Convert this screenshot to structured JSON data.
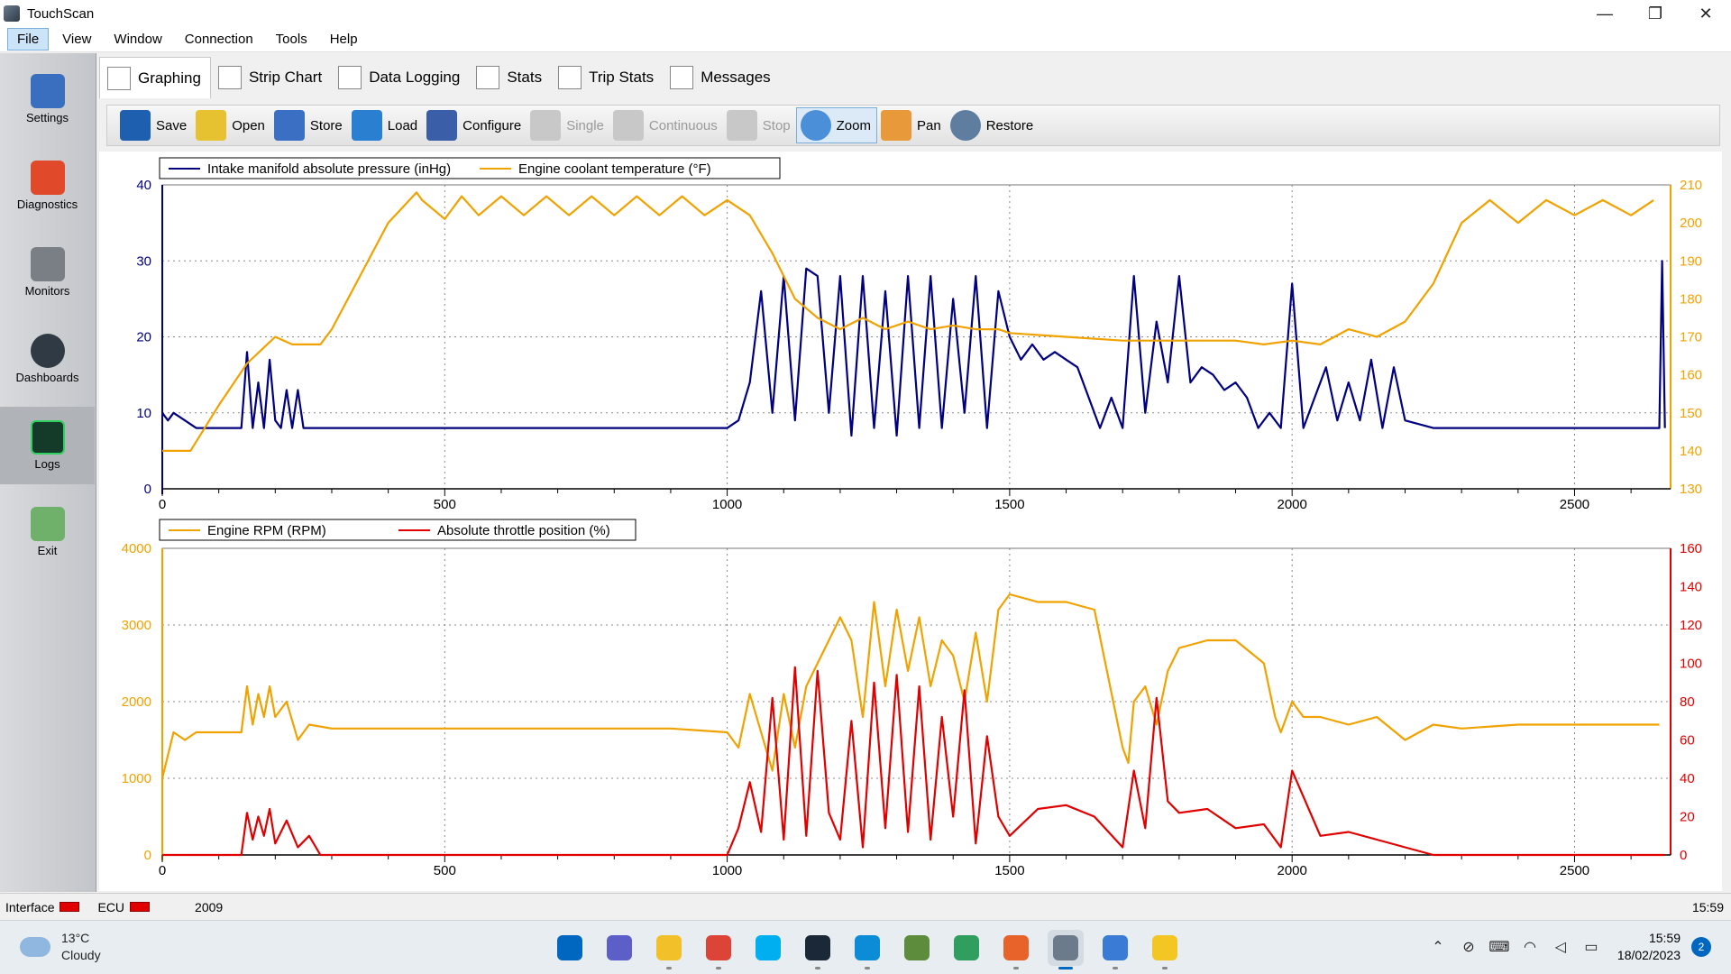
{
  "window": {
    "title": "TouchScan",
    "minimize": "—",
    "restore": "❐",
    "close": "✕"
  },
  "menu": [
    "File",
    "View",
    "Window",
    "Connection",
    "Tools",
    "Help"
  ],
  "nav": [
    {
      "label": "Settings",
      "icon": "checklist-icon"
    },
    {
      "label": "Diagnostics",
      "icon": "car-icon"
    },
    {
      "label": "Monitors",
      "icon": "gauge-icon"
    },
    {
      "label": "Dashboards",
      "icon": "dashboard-icon"
    },
    {
      "label": "Logs",
      "icon": "waveform-icon"
    },
    {
      "label": "Exit",
      "icon": "exit-icon"
    }
  ],
  "tabs": [
    "Graphing",
    "Strip Chart",
    "Data Logging",
    "Stats",
    "Trip Stats",
    "Messages"
  ],
  "toolbar": [
    {
      "label": "Save",
      "icon": "floppy-icon",
      "color": "#1f5fb0"
    },
    {
      "label": "Open",
      "icon": "folder-icon",
      "color": "#e6c230"
    },
    {
      "label": "Store",
      "icon": "store-icon",
      "color": "#3b6fc4"
    },
    {
      "label": "Load",
      "icon": "load-icon",
      "color": "#2a7fd0"
    },
    {
      "label": "Configure",
      "icon": "configure-icon",
      "color": "#3a5ea8"
    },
    {
      "label": "Single",
      "icon": "single-icon",
      "color": "#c8c8c8"
    },
    {
      "label": "Continuous",
      "icon": "continuous-icon",
      "color": "#c8c8c8"
    },
    {
      "label": "Stop",
      "icon": "stop-icon",
      "color": "#c8c8c8"
    },
    {
      "label": "Zoom",
      "icon": "zoom-icon",
      "color": "#4a8fd8"
    },
    {
      "label": "Pan",
      "icon": "hand-icon",
      "color": "#e89a3a"
    },
    {
      "label": "Restore",
      "icon": "restore-icon",
      "color": "#5f7d9e"
    }
  ],
  "chart_data": [
    {
      "type": "line",
      "legend": [
        "Intake manifold absolute pressure (inHg)",
        "Engine coolant temperature (°F)"
      ],
      "xlim": [
        0,
        2670
      ],
      "x_ticks": [
        0,
        500,
        1000,
        1500,
        2000,
        2500
      ],
      "y_left": {
        "range": [
          0,
          40
        ],
        "ticks": [
          0,
          10,
          20,
          30,
          40
        ]
      },
      "y_right": {
        "range": [
          130,
          210
        ],
        "ticks": [
          130,
          140,
          150,
          160,
          170,
          180,
          190,
          200,
          210
        ]
      },
      "grid": true,
      "series": [
        {
          "name": "Intake manifold absolute pressure (inHg)",
          "axis": "left",
          "color": "#000080",
          "x": [
            0,
            10,
            20,
            40,
            60,
            80,
            100,
            120,
            140,
            150,
            160,
            170,
            180,
            190,
            200,
            210,
            220,
            230,
            240,
            250,
            260,
            280,
            300,
            400,
            500,
            600,
            700,
            800,
            900,
            980,
            1000,
            1020,
            1040,
            1060,
            1080,
            1100,
            1120,
            1140,
            1160,
            1180,
            1200,
            1220,
            1240,
            1260,
            1280,
            1300,
            1320,
            1340,
            1360,
            1380,
            1400,
            1420,
            1440,
            1460,
            1480,
            1500,
            1520,
            1540,
            1560,
            1580,
            1600,
            1620,
            1640,
            1660,
            1680,
            1700,
            1720,
            1740,
            1760,
            1780,
            1800,
            1820,
            1840,
            1860,
            1880,
            1900,
            1920,
            1940,
            1960,
            1980,
            2000,
            2020,
            2040,
            2060,
            2080,
            2100,
            2120,
            2140,
            2160,
            2180,
            2200,
            2250,
            2300,
            2400,
            2500,
            2600,
            2640,
            2650,
            2655,
            2660
          ],
          "y": [
            10,
            9,
            10,
            9,
            8,
            8,
            8,
            8,
            8,
            18,
            8,
            14,
            8,
            17,
            9,
            8,
            13,
            8,
            13,
            8,
            8,
            8,
            8,
            8,
            8,
            8,
            8,
            8,
            8,
            8,
            8,
            9,
            14,
            26,
            10,
            28,
            9,
            29,
            28,
            10,
            28,
            7,
            28,
            8,
            26,
            7,
            28,
            8,
            28,
            8,
            25,
            10,
            28,
            8,
            26,
            20,
            17,
            19,
            17,
            18,
            17,
            16,
            12,
            8,
            12,
            8,
            28,
            10,
            22,
            14,
            28,
            14,
            16,
            15,
            13,
            14,
            12,
            8,
            10,
            8,
            27,
            8,
            12,
            16,
            9,
            14,
            9,
            17,
            8,
            16,
            9,
            8,
            8,
            8,
            8,
            8,
            8,
            8,
            30,
            8
          ]
        },
        {
          "name": "Engine coolant temperature (°F)",
          "axis": "right",
          "color": "#f0a300",
          "x": [
            0,
            50,
            100,
            150,
            200,
            230,
            280,
            300,
            350,
            400,
            450,
            460,
            500,
            530,
            560,
            600,
            640,
            680,
            720,
            760,
            800,
            840,
            880,
            920,
            960,
            1000,
            1040,
            1080,
            1120,
            1160,
            1200,
            1240,
            1280,
            1320,
            1360,
            1400,
            1440,
            1480,
            1500,
            1600,
            1700,
            1750,
            1800,
            1900,
            1950,
            2000,
            2050,
            2100,
            2150,
            2200,
            2250,
            2300,
            2350,
            2400,
            2450,
            2500,
            2550,
            2600,
            2640
          ],
          "y": [
            140,
            140,
            152,
            163,
            170,
            168,
            168,
            172,
            186,
            200,
            208,
            206,
            201,
            207,
            202,
            207,
            202,
            207,
            202,
            207,
            202,
            207,
            202,
            207,
            202,
            206,
            202,
            192,
            180,
            175,
            172,
            175,
            172,
            174,
            172,
            173,
            172,
            172,
            171,
            170,
            169,
            169,
            169,
            169,
            168,
            169,
            168,
            172,
            170,
            174,
            184,
            200,
            206,
            200,
            206,
            202,
            206,
            202,
            206
          ]
        }
      ]
    },
    {
      "type": "line",
      "legend": [
        "Engine RPM (RPM)",
        "Absolute throttle position (%)"
      ],
      "xlim": [
        0,
        2670
      ],
      "x_ticks": [
        0,
        500,
        1000,
        1500,
        2000,
        2500
      ],
      "y_left": {
        "range": [
          0,
          4000
        ],
        "ticks": [
          0,
          1000,
          2000,
          3000,
          4000
        ]
      },
      "y_right": {
        "range": [
          0,
          160
        ],
        "ticks": [
          0,
          20,
          40,
          60,
          80,
          100,
          120,
          140,
          160
        ]
      },
      "grid": true,
      "series": [
        {
          "name": "Engine RPM (RPM)",
          "axis": "left",
          "color": "#f0a300",
          "x": [
            0,
            20,
            40,
            60,
            80,
            100,
            140,
            150,
            160,
            170,
            180,
            190,
            200,
            220,
            240,
            260,
            300,
            400,
            500,
            600,
            700,
            800,
            900,
            1000,
            1020,
            1040,
            1060,
            1080,
            1100,
            1120,
            1140,
            1160,
            1180,
            1200,
            1220,
            1240,
            1260,
            1280,
            1300,
            1320,
            1340,
            1360,
            1380,
            1400,
            1420,
            1440,
            1460,
            1480,
            1500,
            1550,
            1600,
            1650,
            1700,
            1710,
            1720,
            1740,
            1760,
            1780,
            1800,
            1850,
            1900,
            1950,
            1970,
            1980,
            2000,
            2020,
            2050,
            2100,
            2150,
            2200,
            2250,
            2300,
            2400,
            2500,
            2600,
            2640,
            2650
          ],
          "y": [
            1000,
            1600,
            1500,
            1600,
            1600,
            1600,
            1600,
            2200,
            1700,
            2100,
            1800,
            2200,
            1800,
            2000,
            1500,
            1700,
            1650,
            1650,
            1650,
            1650,
            1650,
            1650,
            1650,
            1600,
            1400,
            2100,
            1600,
            1100,
            2100,
            1400,
            2200,
            2500,
            2800,
            3100,
            2800,
            1800,
            3300,
            2200,
            3200,
            2400,
            3100,
            2200,
            2800,
            2600,
            2000,
            2900,
            2000,
            3200,
            3400,
            3300,
            3300,
            3200,
            1400,
            1200,
            2000,
            2200,
            1700,
            2400,
            2700,
            2800,
            2800,
            2500,
            1800,
            1600,
            2000,
            1800,
            1800,
            1700,
            1800,
            1500,
            1700,
            1650,
            1700,
            1700,
            1700,
            1700,
            1700
          ]
        },
        {
          "name": "Absolute throttle position (%)",
          "axis": "right",
          "color": "#e00000",
          "x": [
            0,
            140,
            150,
            160,
            170,
            180,
            190,
            200,
            220,
            240,
            260,
            280,
            1000,
            1020,
            1040,
            1060,
            1080,
            1100,
            1120,
            1140,
            1160,
            1180,
            1200,
            1220,
            1240,
            1260,
            1280,
            1300,
            1320,
            1340,
            1360,
            1380,
            1400,
            1420,
            1440,
            1460,
            1480,
            1500,
            1550,
            1600,
            1650,
            1700,
            1720,
            1740,
            1760,
            1780,
            1800,
            1850,
            1900,
            1950,
            1980,
            2000,
            2050,
            2100,
            2150,
            2200,
            2250,
            2300,
            2660
          ],
          "y": [
            0,
            0,
            22,
            8,
            20,
            10,
            24,
            6,
            18,
            4,
            10,
            0,
            0,
            14,
            38,
            12,
            82,
            8,
            98,
            10,
            96,
            22,
            8,
            70,
            4,
            90,
            14,
            94,
            12,
            88,
            8,
            72,
            20,
            86,
            6,
            62,
            20,
            10,
            24,
            26,
            20,
            4,
            44,
            14,
            82,
            28,
            22,
            24,
            14,
            16,
            4,
            44,
            10,
            12,
            8,
            4,
            0,
            0,
            0
          ]
        }
      ]
    }
  ],
  "status": {
    "interface_label": "Interface",
    "ecu_label": "ECU",
    "year": "2009",
    "time": "15:59"
  },
  "taskbar": {
    "weather_temp": "13°C",
    "weather_desc": "Cloudy",
    "apps": [
      {
        "name": "start-icon",
        "color": "#0067c0"
      },
      {
        "name": "teams-icon",
        "color": "#5b5fc7"
      },
      {
        "name": "explorer-icon",
        "color": "#f2c029"
      },
      {
        "name": "chrome-icon",
        "color": "#db4437"
      },
      {
        "name": "skype-icon",
        "color": "#00aff0"
      },
      {
        "name": "steam-icon",
        "color": "#1b2838"
      },
      {
        "name": "edge-icon",
        "color": "#0c8bd6"
      },
      {
        "name": "minecraft-icon",
        "color": "#5d8c3c"
      },
      {
        "name": "edge-dev-icon",
        "color": "#2f9e5f"
      },
      {
        "name": "app-orange-icon",
        "color": "#e8632a"
      },
      {
        "name": "touchscan-icon",
        "color": "#6b7b8c"
      },
      {
        "name": "notepad-icon",
        "color": "#3a7bd5"
      },
      {
        "name": "sticky-icon",
        "color": "#f3c623"
      }
    ],
    "clock_time": "15:59",
    "clock_date": "18/02/2023",
    "notifications": "2"
  }
}
